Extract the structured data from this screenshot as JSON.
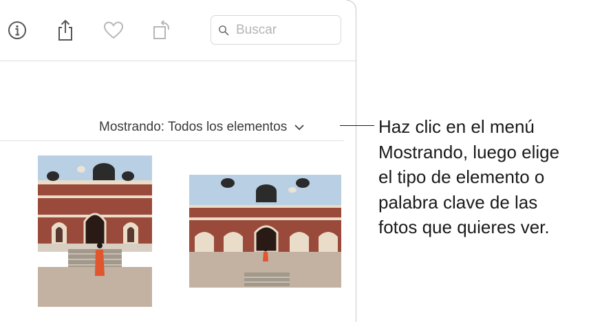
{
  "toolbar": {
    "icons": [
      "info-icon",
      "share-icon",
      "heart-icon",
      "rotate-icon",
      "search-icon"
    ],
    "search": {
      "placeholder": "Buscar",
      "value": ""
    }
  },
  "filter": {
    "label": "Mostrando: Todos los elementos",
    "icon": "chevron-down-icon"
  },
  "photos": [
    {
      "orientation": "portrait",
      "subject": "Mausoleo de piedra roja con persona en sari"
    },
    {
      "orientation": "landscape",
      "subject": "Mausoleo de piedra roja con persona en sari"
    }
  ],
  "callout": {
    "text": "Haz clic en el menú\nMostrando, luego elige\nel tipo de elemento o\npalabra clave de las\nfotos que quieres ver."
  },
  "colors": {
    "sky": "#b9cfe4",
    "sandstone": "#9a4a3a",
    "marble_trim": "#e9ddc9",
    "ground": "#c3b2a2",
    "dome": "#2b2b2b",
    "sari": "#e0562e"
  }
}
